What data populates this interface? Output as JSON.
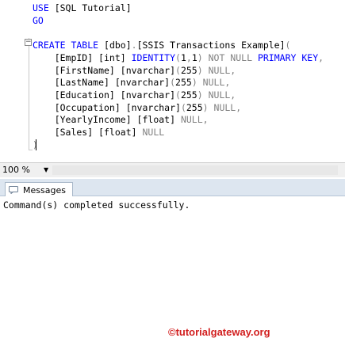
{
  "colors": {
    "keyword": "#0000ff",
    "default": "#000000",
    "operator": "#808080",
    "null_keyword": "#808080",
    "function": "#ff00ff",
    "watermark": "#d22020"
  },
  "editor": {
    "lines": [
      [
        {
          "t": "USE",
          "c": "keyword"
        },
        {
          "t": " [SQL Tutorial]",
          "c": "default"
        }
      ],
      [
        {
          "t": "GO",
          "c": "keyword"
        }
      ],
      [],
      [
        {
          "t": "CREATE TABLE ",
          "c": "keyword"
        },
        {
          "t": "[dbo]",
          "c": "default"
        },
        {
          "t": ".",
          "c": "operator"
        },
        {
          "t": "[SSIS Transactions Example]",
          "c": "default"
        },
        {
          "t": "(",
          "c": "operator"
        }
      ],
      [
        {
          "t": "    [EmpID] [int] ",
          "c": "default"
        },
        {
          "t": "IDENTITY",
          "c": "keyword"
        },
        {
          "t": "(",
          "c": "operator"
        },
        {
          "t": "1",
          "c": "default"
        },
        {
          "t": ",",
          "c": "operator"
        },
        {
          "t": "1",
          "c": "default"
        },
        {
          "t": ") ",
          "c": "operator"
        },
        {
          "t": "NOT NULL",
          "c": "null_keyword"
        },
        {
          "t": " ",
          "c": "default"
        },
        {
          "t": "PRIMARY KEY",
          "c": "keyword"
        },
        {
          "t": ",",
          "c": "operator"
        }
      ],
      [
        {
          "t": "    [FirstName] [nvarchar]",
          "c": "default"
        },
        {
          "t": "(",
          "c": "operator"
        },
        {
          "t": "255",
          "c": "default"
        },
        {
          "t": ") ",
          "c": "operator"
        },
        {
          "t": "NULL,",
          "c": "null_keyword"
        }
      ],
      [
        {
          "t": "    [LastName] [nvarchar]",
          "c": "default"
        },
        {
          "t": "(",
          "c": "operator"
        },
        {
          "t": "255",
          "c": "default"
        },
        {
          "t": ") ",
          "c": "operator"
        },
        {
          "t": "NULL,",
          "c": "null_keyword"
        }
      ],
      [
        {
          "t": "    [Education] [nvarchar]",
          "c": "default"
        },
        {
          "t": "(",
          "c": "operator"
        },
        {
          "t": "255",
          "c": "default"
        },
        {
          "t": ") ",
          "c": "operator"
        },
        {
          "t": "NULL,",
          "c": "null_keyword"
        }
      ],
      [
        {
          "t": "    [Occupation] [nvarchar]",
          "c": "default"
        },
        {
          "t": "(",
          "c": "operator"
        },
        {
          "t": "255",
          "c": "default"
        },
        {
          "t": ") ",
          "c": "operator"
        },
        {
          "t": "NULL,",
          "c": "null_keyword"
        }
      ],
      [
        {
          "t": "    [YearlyIncome] [float] ",
          "c": "default"
        },
        {
          "t": "NULL,",
          "c": "null_keyword"
        }
      ],
      [
        {
          "t": "    [Sales] [float] ",
          "c": "default"
        },
        {
          "t": "NULL",
          "c": "null_keyword"
        }
      ],
      [
        {
          "t": ")",
          "c": "operator"
        }
      ]
    ]
  },
  "statusbar": {
    "zoom": "100 %",
    "watermark": "©tutorialgateway.org"
  },
  "messages": {
    "tab_label": "Messages",
    "text": "Command(s) completed successfully."
  }
}
